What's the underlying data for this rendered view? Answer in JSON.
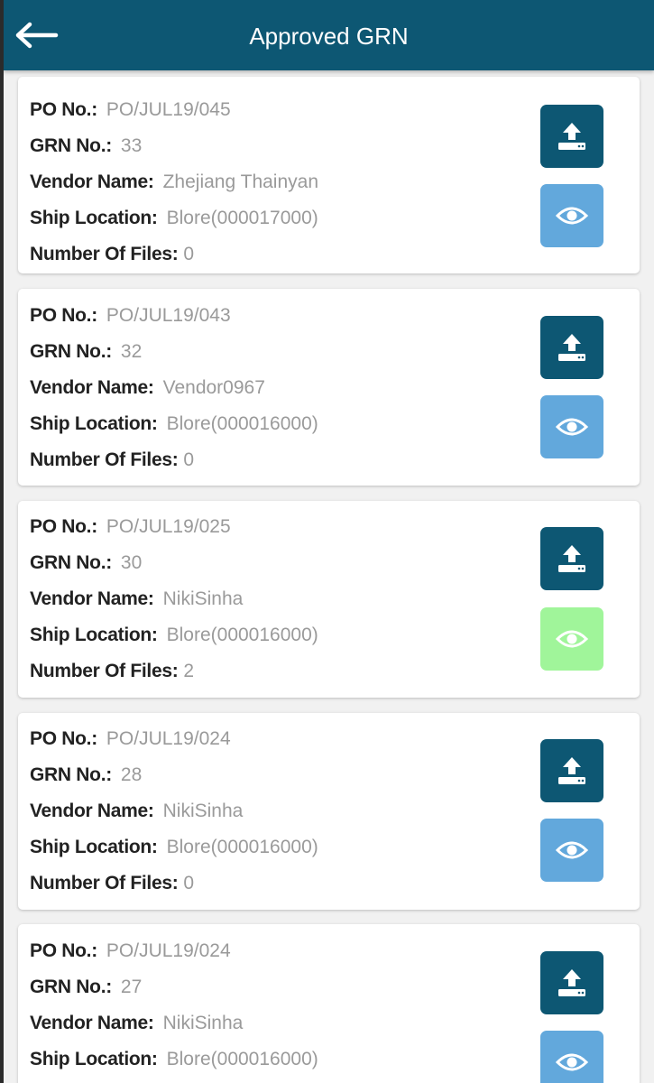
{
  "header": {
    "title": "Approved GRN",
    "back_icon": "arrow-left-icon"
  },
  "colors": {
    "header_bg": "#0d5773",
    "upload_button": "#0d5773",
    "view_button_default": "#62a8dc",
    "view_button_with_files": "#a0f59a"
  },
  "labels": {
    "po": "PO No.:",
    "grn": "GRN No.:",
    "vendor": "Vendor Name:",
    "ship": "Ship Location:",
    "files": "Number Of Files:"
  },
  "cards": [
    {
      "po_no": "PO/JUL19/045",
      "grn_no": "33",
      "vendor_name": "Zhejiang Thainyan",
      "ship_location": "Blore(000017000)",
      "number_of_files": "0",
      "upload_icon": "upload-icon",
      "view_icon": "eye-icon"
    },
    {
      "po_no": "PO/JUL19/043",
      "grn_no": "32",
      "vendor_name": "Vendor0967",
      "ship_location": "Blore(000016000)",
      "number_of_files": "0",
      "upload_icon": "upload-icon",
      "view_icon": "eye-icon"
    },
    {
      "po_no": "PO/JUL19/025",
      "grn_no": "30",
      "vendor_name": "NikiSinha",
      "ship_location": "Blore(000016000)",
      "number_of_files": "2",
      "upload_icon": "upload-icon",
      "view_icon": "eye-icon"
    },
    {
      "po_no": "PO/JUL19/024",
      "grn_no": "28",
      "vendor_name": "NikiSinha",
      "ship_location": "Blore(000016000)",
      "number_of_files": "0",
      "upload_icon": "upload-icon",
      "view_icon": "eye-icon"
    },
    {
      "po_no": "PO/JUL19/024",
      "grn_no": "27",
      "vendor_name": "NikiSinha",
      "ship_location": "Blore(000016000)",
      "number_of_files": "",
      "upload_icon": "upload-icon",
      "view_icon": "eye-icon"
    }
  ]
}
